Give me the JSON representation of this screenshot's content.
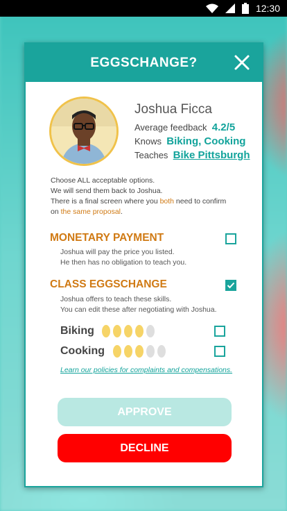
{
  "status_bar": {
    "time": "12:30"
  },
  "dialog": {
    "title": "EGGSCHANGE?",
    "user": {
      "name": "Joshua Ficca",
      "feedback_label": "Average feedback",
      "feedback_value": "4.2/5",
      "knows_label": "Knows",
      "knows_value": "Biking, Cooking",
      "teaches_label": "Teaches",
      "teaches_value": "Bike Pittsburgh"
    },
    "intro": {
      "line1": "Choose ALL acceptable options.",
      "line2": "We will send them back to Joshua.",
      "line3_a": "There is a final screen where you ",
      "line3_b": "both",
      "line3_c": " need to confirm",
      "line4_a": "on ",
      "line4_b": "the same proposal",
      "line4_c": "."
    },
    "monetary": {
      "title": "MONETARY PAYMENT",
      "desc1": "Joshua will pay the price you listed.",
      "desc2": "He then has no obligation to teach you.",
      "checked": false
    },
    "class_exchange": {
      "title": "CLASS EGGSCHANGE",
      "desc1": "Joshua offers to teach these skills.",
      "desc2": "You can edit these after negotiating with Joshua.",
      "checked": true
    },
    "skills": [
      {
        "name": "Biking",
        "rating": 4,
        "max": 5,
        "checked": false
      },
      {
        "name": "Cooking",
        "rating": 3,
        "max": 5,
        "checked": false
      }
    ],
    "policy_link": "Learn our policies for complaints and compensations.",
    "approve_label": "APPROVE",
    "decline_label": "DECLINE"
  },
  "colors": {
    "accent": "#1aa49c",
    "orange": "#d07a14",
    "egg_filled": "#f6d467",
    "egg_empty": "#dedede",
    "decline": "#ff0000",
    "approve_disabled": "#b9e8e2"
  }
}
